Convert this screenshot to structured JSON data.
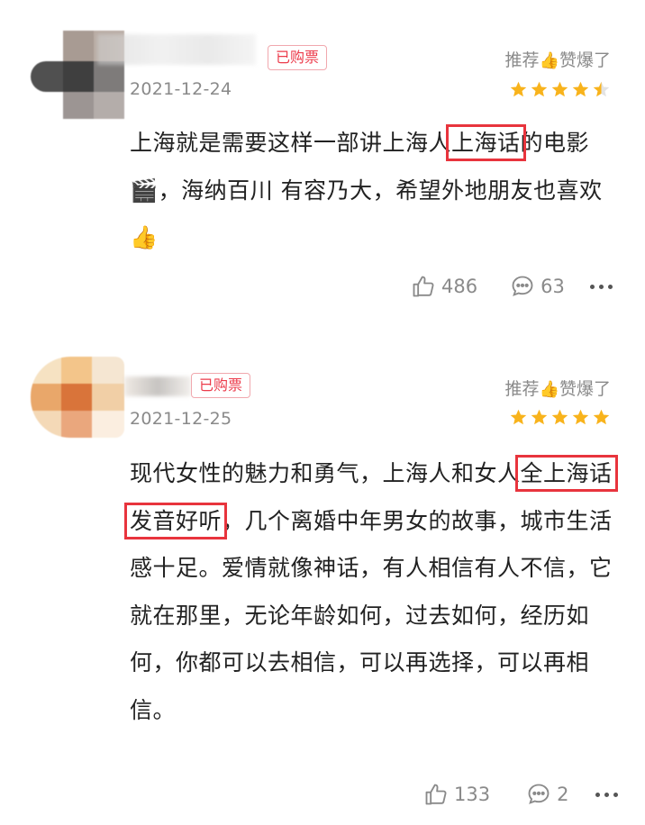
{
  "reviews": [
    {
      "purchased_label": "已购票",
      "date": "2021-12-24",
      "recommend_label": "推荐",
      "recommend_emoji": "👍",
      "rating_label": "赞爆了",
      "rating_stars": 4.5,
      "text_before": "上海就是需要这样一部讲上海人",
      "text_highlight": "上海话",
      "text_after": "的电影🎬，海纳百川 有容乃大，希望外地朋友也喜欢👍",
      "likes": "486",
      "comments": "63",
      "star_color": "#f8b31c"
    },
    {
      "purchased_label": "已购票",
      "date": "2021-12-25",
      "recommend_label": "推荐",
      "recommend_emoji": "👍",
      "rating_label": "赞爆了",
      "rating_stars": 5,
      "text_before": "现代女性的魅力和勇气，上海人和女人",
      "text_highlight": "全上海话发音好听",
      "text_after": "，几个离婚中年男女的故事，城市生活感十足。爱情就像神话，有人相信有人不信，它就在那里，无论年龄如何，过去如何，经历如何，你都可以去相信，可以再选择，可以再相信。",
      "likes": "133",
      "comments": "2",
      "star_color": "#f8b31c"
    }
  ],
  "icons": {
    "like": "thumbs-up-icon",
    "comment": "comment-bubble-icon",
    "more": "more-dots-icon",
    "star": "star-icon"
  },
  "colors": {
    "highlight_box": "#e8343d",
    "tag_text": "#ec3b4b",
    "meta_gray": "#8a8a8a"
  }
}
